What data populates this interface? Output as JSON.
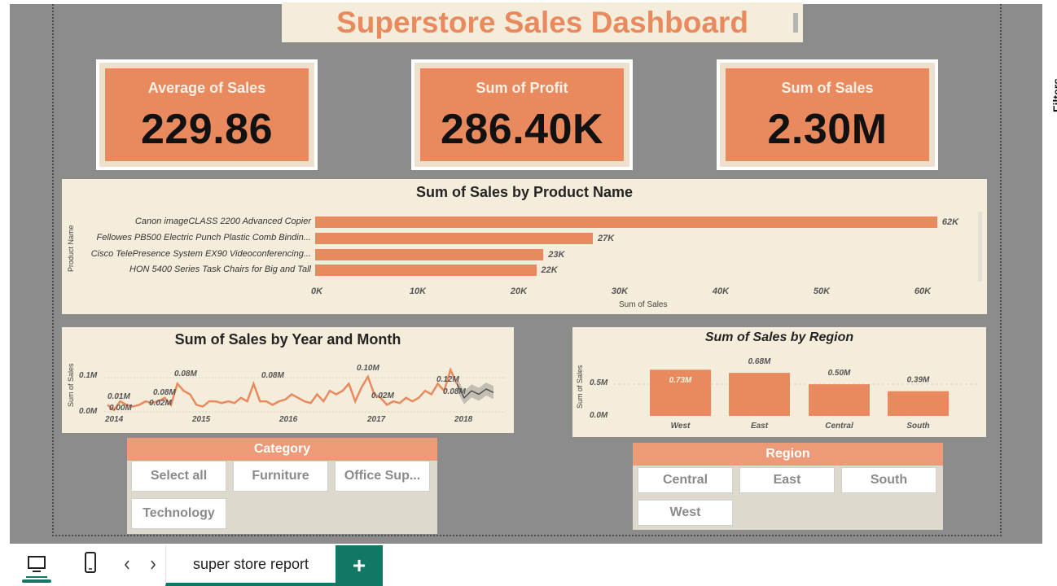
{
  "dashboard": {
    "title": "Superstore Sales Dashboard"
  },
  "kpis": [
    {
      "label": "Average of Sales",
      "value": "229.86"
    },
    {
      "label": "Sum of Profit",
      "value": "286.40K"
    },
    {
      "label": "Sum of Sales",
      "value": "2.30M"
    }
  ],
  "colors": {
    "accent": "#e98a5e",
    "panel": "#f5eddb",
    "canvas": "#8c8c8c",
    "tab_green": "#117865",
    "slicer_header": "#ed9a78"
  },
  "chart_data": [
    {
      "type": "bar",
      "orientation": "horizontal",
      "title": "Sum of Sales by Product Name",
      "xlabel": "Sum of Sales",
      "ylabel": "Product Name",
      "categories": [
        "Canon imageCLASS 2200 Advanced Copier",
        "Fellowes PB500 Electric Punch Plastic Comb Bindin...",
        "Cisco TelePresence System EX90 Videoconferencing...",
        "HON 5400 Series Task Chairs for Big and Tall"
      ],
      "values": [
        61600,
        27500,
        22600,
        21900
      ],
      "data_labels": [
        "62K",
        "27K",
        "23K",
        "22K"
      ],
      "xlim": [
        0,
        62000
      ],
      "xticks": [
        "0K",
        "10K",
        "20K",
        "30K",
        "40K",
        "50K",
        "60K"
      ]
    },
    {
      "type": "line",
      "title": "Sum of Sales by Year and Month",
      "ylabel": "Sum of Sales",
      "xticks": [
        "2014",
        "2015",
        "2016",
        "2017",
        "2018"
      ],
      "yticks": [
        "0.0M",
        "0.1M"
      ],
      "ylim": [
        0,
        0.13
      ],
      "values": [
        0.02,
        0.005,
        0.03,
        0.02,
        0.015,
        0.02,
        0.03,
        0.025,
        0.03,
        0.04,
        0.02,
        0.08,
        0.06,
        0.05,
        0.02,
        0.015,
        0.03,
        0.03,
        0.025,
        0.03,
        0.025,
        0.04,
        0.03,
        0.08,
        0.03,
        0.03,
        0.02,
        0.03,
        0.035,
        0.05,
        0.04,
        0.03,
        0.025,
        0.05,
        0.03,
        0.06,
        0.05,
        0.06,
        0.08,
        0.03,
        0.07,
        0.1,
        0.05,
        0.04,
        0.02,
        0.03,
        0.025,
        0.04,
        0.03,
        0.04,
        0.06,
        0.05,
        0.08,
        0.06,
        0.12,
        0.08
      ],
      "forecast": [
        0.08,
        0.04,
        0.06,
        0.05,
        0.065,
        0.055
      ],
      "data_labels": [
        "0.01M",
        "0.00M",
        "0.02M",
        "0.08M",
        "0.08M",
        "0.08M",
        "0.10M",
        "0.02M",
        "0.12M",
        "0.08M"
      ]
    },
    {
      "type": "bar",
      "title": "Sum of Sales by Region",
      "ylabel": "Sum of Sales",
      "categories": [
        "West",
        "East",
        "Central",
        "South"
      ],
      "values": [
        0.73,
        0.68,
        0.5,
        0.39
      ],
      "data_labels": [
        "0.73M",
        "0.68M",
        "0.50M",
        "0.39M"
      ],
      "yticks": [
        "0.0M",
        "0.5M"
      ],
      "ylim": [
        0,
        0.9
      ]
    }
  ],
  "category_slicer": {
    "header": "Category",
    "options": [
      "Select all",
      "Furniture",
      "Office Sup...",
      "Technology"
    ]
  },
  "region_slicer": {
    "header": "Region",
    "options": [
      "Central",
      "East",
      "South",
      "West"
    ]
  },
  "bottom_bar": {
    "tab_label": "super store report",
    "add_label": "+"
  }
}
